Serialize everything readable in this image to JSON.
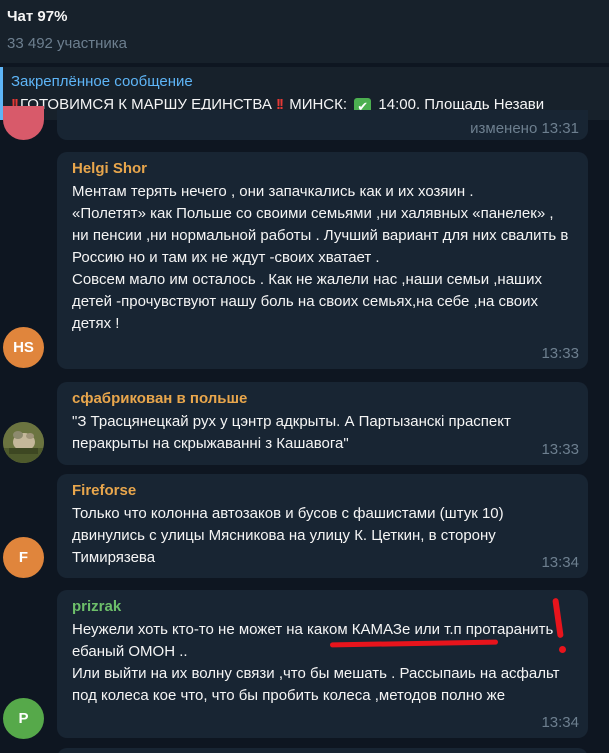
{
  "header": {
    "title": "Чат 97%",
    "subtitle": "33 492 участника"
  },
  "pinned": {
    "label": "Закреплённое сообщение",
    "text_a": "ГОТОВИМСЯ К МАРШУ ЕДИНСТВА",
    "text_b": "МИНСК:",
    "check_glyph": "✔",
    "text_c": "14:00. Площадь Незави",
    "icons": [
      "double-exclamation-icon",
      "check-mark-icon"
    ]
  },
  "partial_message": {
    "time": "изменено 13:31",
    "avatar_color": "#d85a6a"
  },
  "messages": [
    {
      "sender": "Helgi Shor",
      "sender_color": "#e8a64c",
      "text": "Ментам терять нечего , они запачкались как и их хозяин .\n«Полетят» как Польше со своими семьями ,ни халявных «панелек» , ни пенсии ,ни нормальной работы . Лучший вариант для них свалить в Россию но и там их не ждут -своих хватает .\n Совсем мало им осталось . Как не жалели нас ,наши семьи ,наших детей -прочувствуют нашу боль на своих семьях,на себе ,на своих детях !",
      "time": "13:33",
      "avatar_initials": "HS",
      "avatar_color": "#e0853c"
    },
    {
      "sender": "сфабрикован в польше",
      "sender_color": "#e8a64c",
      "text": "\"З Трасцянецкай рух у цэнтр адкрыты. А Партызанскі праспект перакрыты на скрыжаванні з Кашавога\"",
      "time": "13:33",
      "avatar_type": "photo"
    },
    {
      "sender": "Fireforse",
      "sender_color": "#e8a64c",
      "text": "Только что колонна автозаков и бусов с фашистами (штук 10) двинулись с улицы Мясникова на улицу К. Цеткин, в сторону Тимирязева",
      "time": "13:34",
      "avatar_initials": "F",
      "avatar_color": "#e0853c"
    },
    {
      "sender": "prizrak",
      "sender_color": "#6dbf6a",
      "text": "Неужели хоть кто-то не может на каком КАМАЗе или т.п протаранить ебаный ОМОН ..\nИли выйти на их волну связи ,что бы мешать . Рассыпаиь на асфальт под колеса кое что, что бы пробить колеса ,методов полно же",
      "time": "13:34",
      "avatar_initials": "P",
      "avatar_color": "#56a94a"
    }
  ],
  "annotation": {
    "color": "#e8141c"
  }
}
